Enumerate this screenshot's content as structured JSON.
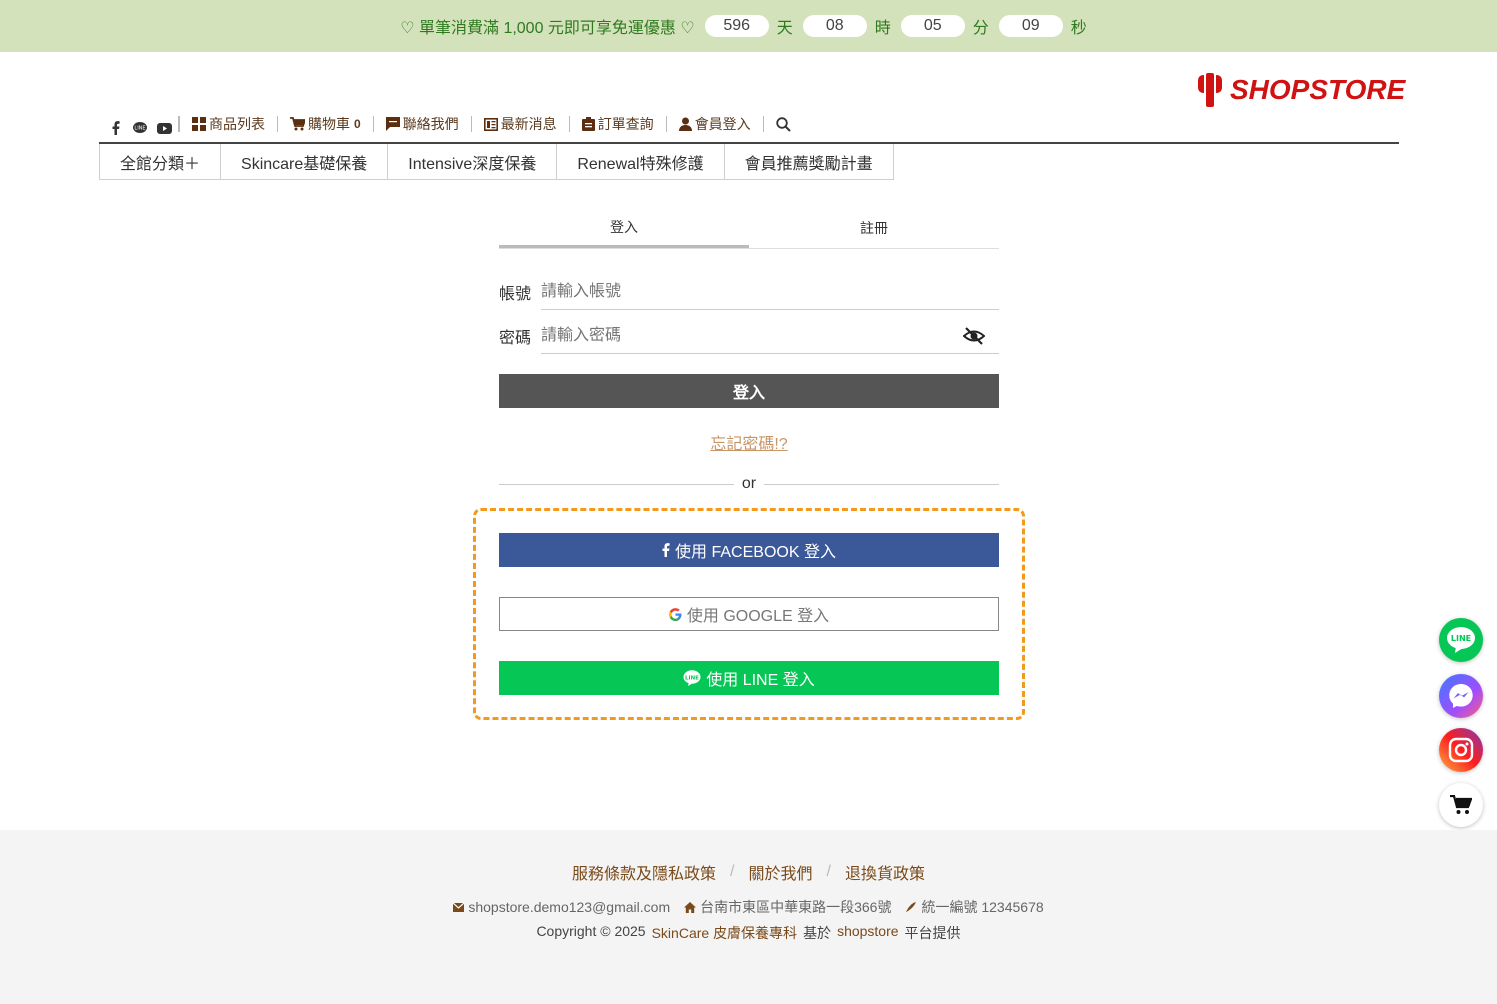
{
  "promo": {
    "message": "♡ 單筆消費滿 1,000 元即可享免運優惠 ♡",
    "countdown": [
      {
        "value": "596",
        "unit": "天"
      },
      {
        "value": "08",
        "unit": "時"
      },
      {
        "value": "05",
        "unit": "分"
      },
      {
        "value": "09",
        "unit": "秒"
      }
    ],
    "bg_color": "#d4e2bc",
    "text_color": "#2f7a1f"
  },
  "logo": {
    "text": "SHOPSTORE",
    "color": "#d01212"
  },
  "social_icons": [
    "facebook-icon",
    "line-icon",
    "youtube-icon"
  ],
  "nav": {
    "products": "商品列表",
    "cart": "購物車",
    "cart_count": "0",
    "contact": "聯絡我們",
    "news": "最新消息",
    "orders": "訂單查詢",
    "member_login": "會員登入"
  },
  "categories": [
    "全館分類＋",
    "Skincare基礎保養",
    "Intensive深度保養",
    "Renewal特殊修護",
    "會員推薦獎勵計畫"
  ],
  "login": {
    "tab_login": "登入",
    "tab_register": "註冊",
    "account_label": "帳號",
    "account_placeholder": "請輸入帳號",
    "password_label": "密碼",
    "password_placeholder": "請輸入密碼",
    "submit": "登入",
    "forgot": "忘記密碼!?",
    "or": "or",
    "facebook": "使用 FACEBOOK 登入",
    "google": "使用 GOOGLE 登入",
    "line": "使用 LINE 登入"
  },
  "colors": {
    "facebook": "#3b5998",
    "line": "#06c755",
    "highlight_border": "#f39a1e",
    "login_button": "#555555"
  },
  "float_buttons": [
    "line-icon",
    "messenger-icon",
    "instagram-icon",
    "cart-icon",
    "arrow-up-icon"
  ],
  "footer": {
    "links": [
      "服務條款及隱私政策",
      "關於我們",
      "退換貨政策"
    ],
    "email": "shopstore.demo123@gmail.com",
    "address": "台南市東區中華東路一段366號",
    "tax_id": "統一編號 12345678",
    "copyright": "Copyright © 2025",
    "store_name": "SkinCare 皮膚保養專科",
    "based_on": "基於",
    "platform": "shopstore",
    "provided": "平台提供"
  }
}
